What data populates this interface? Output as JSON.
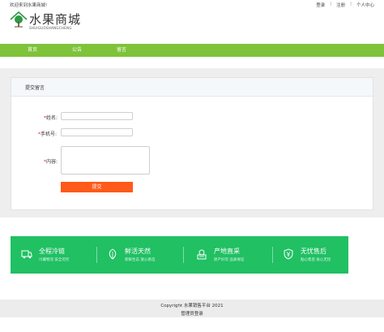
{
  "topbar": {
    "welcome": "欢迎来到水果商城!",
    "links": [
      "登录",
      "注册",
      "个人中心"
    ],
    "separator": "|"
  },
  "logo": {
    "name": "水果商城",
    "pinyin": "SHUIGUOSHANGCHENG",
    "icon": "tree-house-icon"
  },
  "nav": {
    "items": [
      "首页",
      "公告",
      "留言"
    ]
  },
  "form": {
    "title": "提交留言",
    "required_mark": "*",
    "name_label": "姓名:",
    "phone_label": "手机号:",
    "content_label": "内容:",
    "name_value": "",
    "phone_value": "",
    "content_value": "",
    "submit_label": "提交"
  },
  "features": [
    {
      "title": "全程冷链",
      "sub": "冷藏物流 安全可控",
      "icon": "truck-icon"
    },
    {
      "title": "鲜活天然",
      "sub": "新鲜生态 放心易选",
      "icon": "leaf-icon"
    },
    {
      "title": "产地直采",
      "sub": "原产好货 品质保证",
      "icon": "basket-icon"
    },
    {
      "title": "无忧售后",
      "sub": "贴心售后 省心无忧",
      "icon": "yen-icon"
    }
  ],
  "footer": {
    "copyright": "Copyright 水果销售平台 2021",
    "admin_link": "管理员登录"
  },
  "colors": {
    "nav_green": "#7fc33a",
    "feature_green": "#20c063",
    "submit_orange": "#ff5a1a",
    "logo_green": "#2e9a46"
  }
}
